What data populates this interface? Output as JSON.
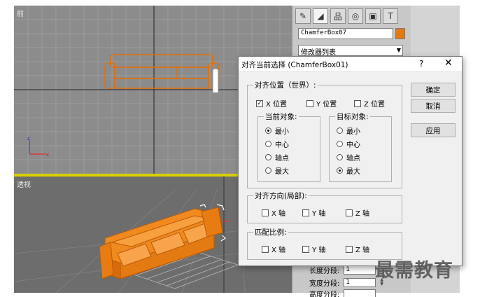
{
  "viewports": {
    "front_label": "前",
    "perspective_label": "透视"
  },
  "command_panel": {
    "object_name": "ChamferBox07",
    "object_color": "#e07b14",
    "modifier_list": "修改器列表",
    "toolbar_icons": [
      "create-icon",
      "modify-icon",
      "hierarchy-icon",
      "motion-icon",
      "display-icon",
      "utilities-icon"
    ],
    "params": [
      {
        "label": "长度分段:",
        "value": "1"
      },
      {
        "label": "宽度分段:",
        "value": "1"
      },
      {
        "label": "高度分段:",
        "value": ""
      }
    ]
  },
  "dialog": {
    "title": "对齐当前选择 (ChamferBox01)",
    "help": "?",
    "close": "✕",
    "align_position": {
      "label": "对齐位置（世界）:",
      "x": {
        "label": "X 位置",
        "checked": true
      },
      "y": {
        "label": "Y 位置",
        "checked": false
      },
      "z": {
        "label": "Z 位置",
        "checked": false
      }
    },
    "current_object": {
      "label": "当前对象:",
      "options": [
        "最小",
        "中心",
        "轴点",
        "最大"
      ],
      "selected": "最小"
    },
    "target_object": {
      "label": "目标对象:",
      "options": [
        "最小",
        "中心",
        "轴点",
        "最大"
      ],
      "selected": "最大"
    },
    "align_orientation": {
      "label": "对齐方向(局部):",
      "x": "X 轴",
      "y": "Y 轴",
      "z": "Z 轴"
    },
    "match_scale": {
      "label": "匹配比例:",
      "x": "X 轴",
      "y": "Y 轴",
      "z": "Z 轴"
    },
    "buttons": {
      "ok": "确定",
      "cancel": "取消",
      "apply": "应用"
    }
  },
  "watermark": "最需教育"
}
